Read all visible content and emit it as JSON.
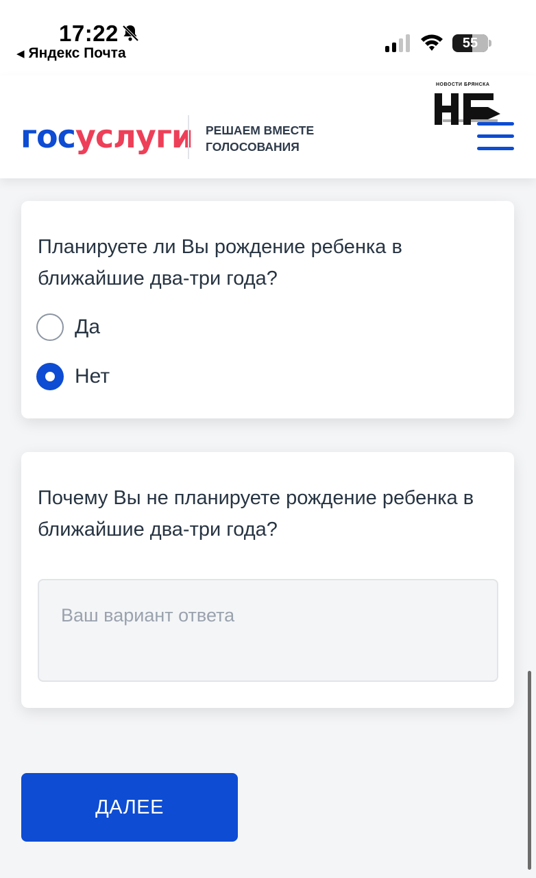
{
  "status_bar": {
    "time": "17:22",
    "back_app": "Яндекс Почта",
    "battery_level": "55"
  },
  "header": {
    "logo_part1": "гос",
    "logo_part2": "услуги",
    "subtitle_line1": "РЕШАЕМ ВМЕСТЕ",
    "subtitle_line2": "ГОЛОСОВАНИЯ",
    "watermark_small": "НОВОСТИ БРЯНСКА",
    "watermark_logo": "НБ"
  },
  "question1": {
    "text": "Планируете ли Вы рождение ребенка в ближайшие два-три года?",
    "options": [
      {
        "label": "Да",
        "checked": false
      },
      {
        "label": "Нет",
        "checked": true
      }
    ]
  },
  "question2": {
    "text": "Почему Вы не планируете рождение ребенка в ближайшие два-три года?",
    "placeholder": "Ваш вариант ответа",
    "value": ""
  },
  "next_button": {
    "label": "ДАЛЕЕ"
  },
  "colors": {
    "accent": "#0d4cd3",
    "brand_red": "#ee3f58",
    "text": "#273442"
  }
}
